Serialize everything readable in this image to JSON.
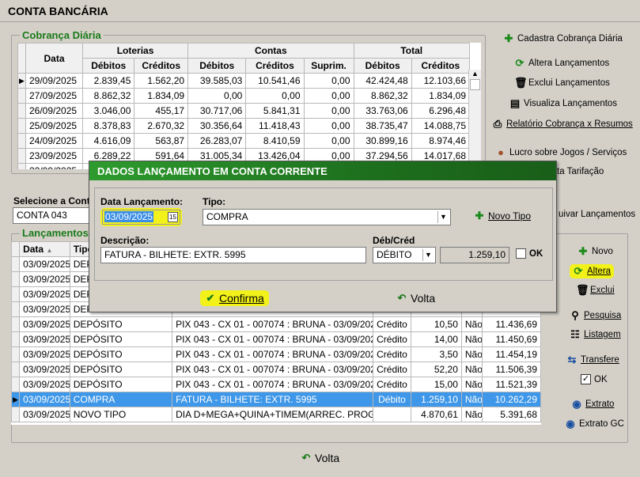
{
  "window": {
    "title": "CONTA BANCÁRIA"
  },
  "cobranca": {
    "title": "Cobrança Diária",
    "group_headers": [
      "Loterias",
      "Contas",
      "Total"
    ],
    "col_data": "Data",
    "sub_headers": [
      "Débitos",
      "Créditos",
      "Débitos",
      "Créditos",
      "Suprim.",
      "Débitos",
      "Créditos"
    ],
    "rows": [
      [
        "29/09/2025",
        "2.839,45",
        "1.562,20",
        "39.585,03",
        "10.541,46",
        "0,00",
        "42.424,48",
        "12.103,66"
      ],
      [
        "27/09/2025",
        "8.862,32",
        "1.834,09",
        "0,00",
        "0,00",
        "0,00",
        "8.862,32",
        "1.834,09"
      ],
      [
        "26/09/2025",
        "3.046,00",
        "455,17",
        "30.717,06",
        "5.841,31",
        "0,00",
        "33.763,06",
        "6.296,48"
      ],
      [
        "25/09/2025",
        "8.378,83",
        "2.670,32",
        "30.356,64",
        "11.418,43",
        "0,00",
        "38.735,47",
        "14.088,75"
      ],
      [
        "24/09/2025",
        "4.616,09",
        "563,87",
        "26.283,07",
        "8.410,59",
        "0,00",
        "30.899,16",
        "8.974,46"
      ],
      [
        "23/09/2025",
        "6.289,22",
        "591,64",
        "31.005,34",
        "13.426,04",
        "0,00",
        "37.294,56",
        "14.017,68"
      ],
      [
        "22/09/2025",
        "",
        "",
        "",
        "",
        "",
        "",
        ""
      ]
    ]
  },
  "side_buttons_top": [
    {
      "label": "Cadastra Cobrança Diária",
      "icon": "plus-icon"
    },
    {
      "label": "Altera Lançamentos",
      "icon": "refresh-icon"
    },
    {
      "label": "Exclui Lançamentos",
      "icon": "trash-icon"
    },
    {
      "label": "Visualiza Lançamentos",
      "icon": "document-icon"
    },
    {
      "label": "Relatório Cobrança x Resumos",
      "icon": "printer-icon"
    },
    {
      "label": "Lucro sobre Jogos / Serviços",
      "icon": "coins-icon"
    },
    {
      "label": "ta Tarifação",
      "icon": "none"
    },
    {
      "label": "uivar Lançamentos",
      "icon": "none"
    }
  ],
  "select_account": {
    "label": "Selecione a Cont",
    "value": "CONTA 043"
  },
  "lancamentos": {
    "title": "Lançamentos",
    "headers": [
      "Data",
      "Tipo"
    ],
    "rows": [
      [
        "03/09/2025",
        "DEP",
        "",
        "",
        "",
        "",
        "",
        ""
      ],
      [
        "03/09/2025",
        "DEP",
        "",
        "",
        "",
        "",
        "",
        ""
      ],
      [
        "03/09/2025",
        "DEP",
        "",
        "",
        "",
        "",
        "",
        ""
      ],
      [
        "03/09/2025",
        "DEP",
        "",
        "",
        "",
        "",
        "",
        ""
      ],
      [
        "03/09/2025",
        "DEPÓSITO",
        "PIX 043 - CX 01 - 007074 : BRUNA - 03/09/2025 -",
        "Crédito",
        "10,50",
        "Não",
        "11.436,69"
      ],
      [
        "03/09/2025",
        "DEPÓSITO",
        "PIX 043 - CX 01 - 007074 : BRUNA - 03/09/2025 -",
        "Crédito",
        "14,00",
        "Não",
        "11.450,69"
      ],
      [
        "03/09/2025",
        "DEPÓSITO",
        "PIX 043 - CX 01 - 007074 : BRUNA - 03/09/2025 -",
        "Crédito",
        "3,50",
        "Não",
        "11.454,19"
      ],
      [
        "03/09/2025",
        "DEPÓSITO",
        "PIX 043 - CX 01 - 007074 : BRUNA - 03/09/2025 -",
        "Crédito",
        "52,20",
        "Não",
        "11.506,39"
      ],
      [
        "03/09/2025",
        "DEPÓSITO",
        "PIX 043 - CX 01 - 007074 : BRUNA - 03/09/2025 -",
        "Crédito",
        "15,00",
        "Não",
        "11.521,39"
      ],
      [
        "03/09/2025",
        "COMPRA",
        "FATURA - BILHETE: EXTR. 5995",
        "Débito",
        "1.259,10",
        "Não",
        "10.262,29"
      ],
      [
        "03/09/2025",
        "NOVO TIPO",
        "DIA D+MEGA+QUINA+TIMEM(ARREC. PROG - 02092",
        "",
        "4.870,61",
        "Não",
        "5.391,68"
      ]
    ]
  },
  "side_buttons_bottom": {
    "novo": "Novo",
    "altera": "Altera",
    "exclui": "Exclui",
    "pesquisa": "Pesquisa",
    "listagem": "Listagem",
    "transfere": "Transfere",
    "ok": "OK",
    "extrato": "Extrato",
    "extrato_gc": "Extrato GC"
  },
  "dialog": {
    "title": "DADOS LANÇAMENTO EM CONTA CORRENTE",
    "data_label": "Data Lançamento:",
    "data_value": "03/09/2025",
    "tipo_label": "Tipo:",
    "tipo_value": "COMPRA",
    "novo_tipo": "Novo Tipo",
    "descricao_label": "Descrição:",
    "descricao_value": "FATURA - BILHETE: EXTR. 5995",
    "debcred_label": "Déb/Créd",
    "debcred_value": "DÉBITO",
    "valor": "1.259,10",
    "ok_label": "OK",
    "confirma": "Confirma",
    "volta": "Volta"
  },
  "footer": {
    "volta": "Volta"
  }
}
